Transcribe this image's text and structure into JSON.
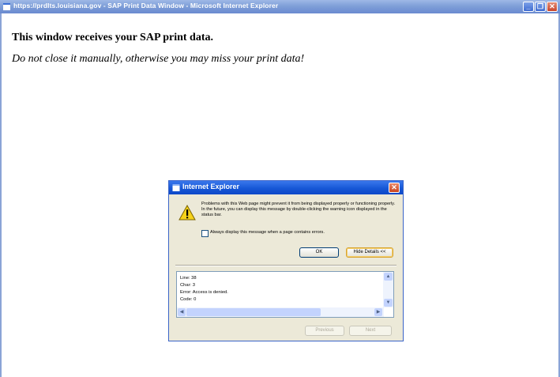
{
  "window": {
    "title": "https://prdlts.louisiana.gov - SAP Print Data Window - Microsoft Internet Explorer",
    "minimize_glyph": "_",
    "maximize_glyph": "❐",
    "close_glyph": "✕"
  },
  "page": {
    "heading": "This window receives your SAP print data.",
    "warning": "Do not close it manually, otherwise you may miss your print data!"
  },
  "dialog": {
    "title": "Internet Explorer",
    "close_glyph": "✕",
    "message": "Problems with this Web page might prevent it from being displayed properly or functioning properly. In the future, you can display this message by double-clicking the warning icon displayed in the status bar.",
    "checkbox_label": "Always display this message when a page contains errors.",
    "checkbox_checked": false,
    "ok_label": "OK",
    "hide_details_label": "Hide Details <<",
    "details": {
      "line": "Line: 38",
      "char": "Char: 3",
      "error": "Error: Access is denied.",
      "code": "Code: 0"
    },
    "previous_label": "Previous",
    "next_label": "Next"
  },
  "colors": {
    "titlebar": "#7f9fd8",
    "dialog_titlebar": "#1657d6",
    "dialog_bg": "#ece9d8"
  }
}
